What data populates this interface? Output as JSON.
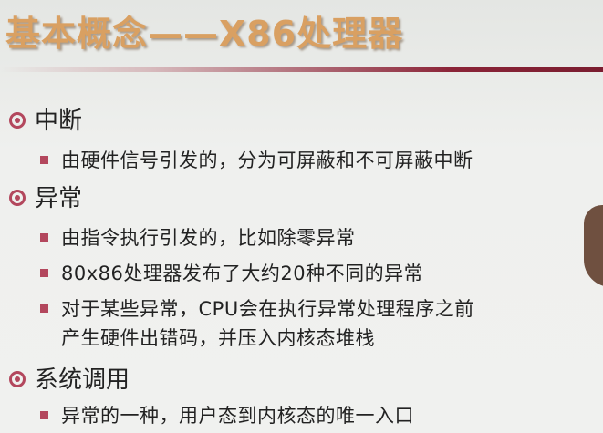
{
  "slide": {
    "title": "基本概念——X86处理器",
    "sections": [
      {
        "heading": "中断",
        "items": [
          {
            "text": "由硬件信号引发的，分为可屏蔽和不可屏蔽中断"
          }
        ]
      },
      {
        "heading": "异常",
        "items": [
          {
            "text": "由指令执行引发的，比如除零异常"
          },
          {
            "text": "80x86处理器发布了大约20种不同的异常"
          },
          {
            "text": "对于某些异常，CPU会在执行异常处理程序之前",
            "continuation": "产生硬件出错码，并压入内核态堆栈"
          }
        ]
      },
      {
        "heading": "系统调用",
        "items": [
          {
            "text": "异常的一种，用户态到内核态的唯一入口"
          }
        ]
      }
    ]
  },
  "colors": {
    "title": "#d9a062",
    "accent": "#b3475d",
    "rule": "#8b2438",
    "text": "#222222"
  }
}
